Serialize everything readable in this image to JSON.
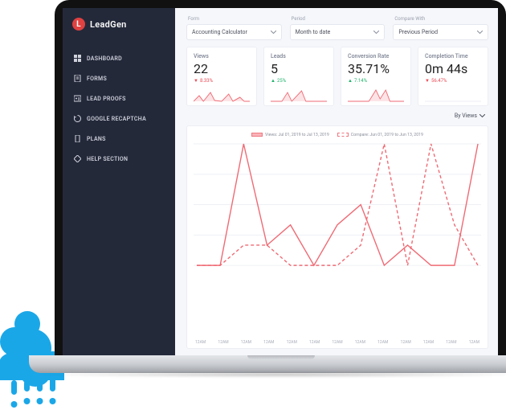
{
  "brand": {
    "initial": "L",
    "name": "LeadGen"
  },
  "sidebar": {
    "items": [
      {
        "label": "DASHBOARD"
      },
      {
        "label": "FORMS"
      },
      {
        "label": "LEAD PROOFS"
      },
      {
        "label": "GOOGLE RECAPTCHA"
      },
      {
        "label": "PLANS"
      },
      {
        "label": "HELP SECTION"
      }
    ]
  },
  "filters": {
    "form": {
      "label": "Form",
      "value": "Accounting Calculator"
    },
    "period": {
      "label": "Period",
      "value": "Month to date"
    },
    "compare": {
      "label": "Compare With",
      "value": "Previous Period"
    }
  },
  "cards": {
    "views": {
      "title": "Views",
      "value": "22",
      "delta": "8.33%",
      "direction": "down"
    },
    "leads": {
      "title": "Leads",
      "value": "5",
      "delta": "25%",
      "direction": "up"
    },
    "conversion": {
      "title": "Conversion Rate",
      "value": "35.71%",
      "delta": "7.14%",
      "direction": "up"
    },
    "completion": {
      "title": "Completion Time",
      "value": "0m 44s",
      "delta": "56.47%",
      "direction": "down"
    }
  },
  "by_views_label": "By Views",
  "legend": {
    "main": "Views: Jul 01, 2019 to Jul 13, 2019",
    "compare": "Compare: Jun 01, 2019 to Jun 13, 2019"
  },
  "chart_data": {
    "type": "line",
    "categories": [
      "12AM",
      "12AM",
      "12AM",
      "12AM",
      "12AM",
      "12AM",
      "12AM",
      "12AM",
      "12AM",
      "12AM",
      "12AM",
      "12AM",
      "12AM"
    ],
    "series": [
      {
        "name": "Views: Jul 01, 2019 to Jul 13, 2019",
        "style": "solid",
        "values": [
          0,
          0,
          6,
          1,
          2,
          0,
          2,
          3,
          0,
          1,
          0,
          0,
          6
        ]
      },
      {
        "name": "Compare: Jun 01, 2019 to Jun 13, 2019",
        "style": "dashed",
        "values": [
          0,
          0,
          1,
          1,
          0,
          0,
          0,
          1,
          6,
          0,
          6,
          2,
          0
        ]
      }
    ],
    "ylim": [
      0,
      6
    ],
    "ylabel": "",
    "xlabel": "",
    "title": ""
  },
  "colors": {
    "accent_red": "#ef6a74",
    "accent_red_soft": "#f8b4b9",
    "green": "#21b26b",
    "sidebar_bg": "#24293a"
  }
}
